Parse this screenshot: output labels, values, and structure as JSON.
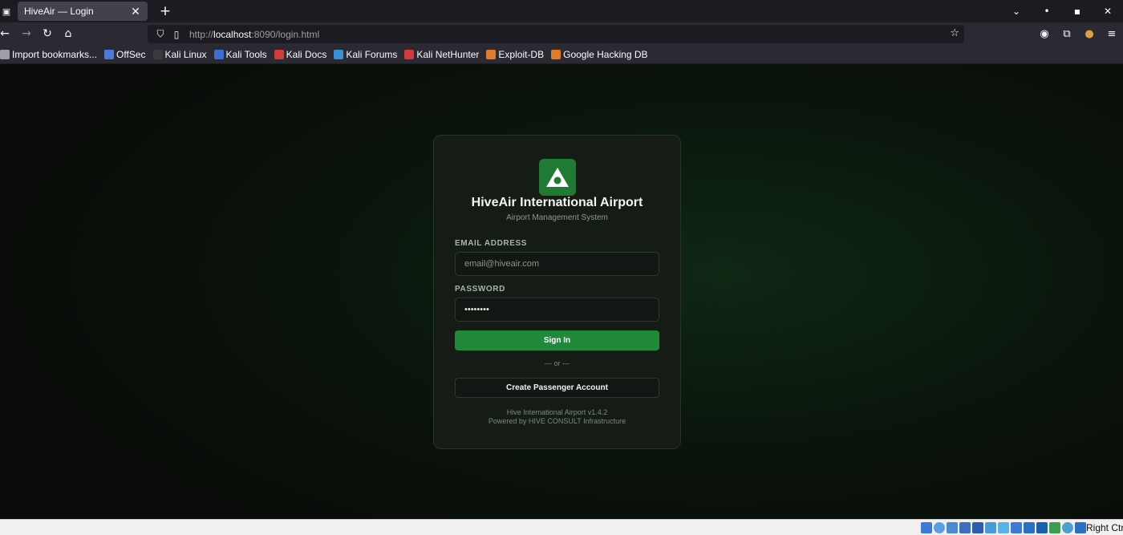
{
  "browser": {
    "tab_title": "HiveAir — Login",
    "tab_close": "✕",
    "new_tab": "+",
    "url_prefix": "http://",
    "url_host": "localhost",
    "url_rest": ":8090/login.html",
    "bookmarks": [
      {
        "label": "Import bookmarks...",
        "color": "#9e9ea6"
      },
      {
        "label": "OffSec",
        "color": "#4a7bd8"
      },
      {
        "label": "Kali Linux",
        "color": "#3a3a3a"
      },
      {
        "label": "Kali Tools",
        "color": "#3b6fd6"
      },
      {
        "label": "Kali Docs",
        "color": "#d23b3b"
      },
      {
        "label": "Kali Forums",
        "color": "#3b8fd6"
      },
      {
        "label": "Kali NetHunter",
        "color": "#d23b3b"
      },
      {
        "label": "Exploit-DB",
        "color": "#e07b2a"
      },
      {
        "label": "Google Hacking DB",
        "color": "#e07b2a"
      }
    ]
  },
  "login": {
    "title": "HiveAir International Airport",
    "subtitle": "Airport Management System",
    "email_label": "EMAIL ADDRESS",
    "email_placeholder": "email@hiveair.com",
    "password_label": "PASSWORD",
    "password_value": "••••••••",
    "signin_label": "Sign In",
    "divider": "— or —",
    "create_label": "Create Passenger Account",
    "footer_version": "Hive International Airport v1.4.2",
    "footer_powered": "Powered by HIVE CONSULT Infrastructure",
    "accent_color": "#208a3a"
  },
  "vm_status": {
    "host_key": "Right Ctrl"
  }
}
